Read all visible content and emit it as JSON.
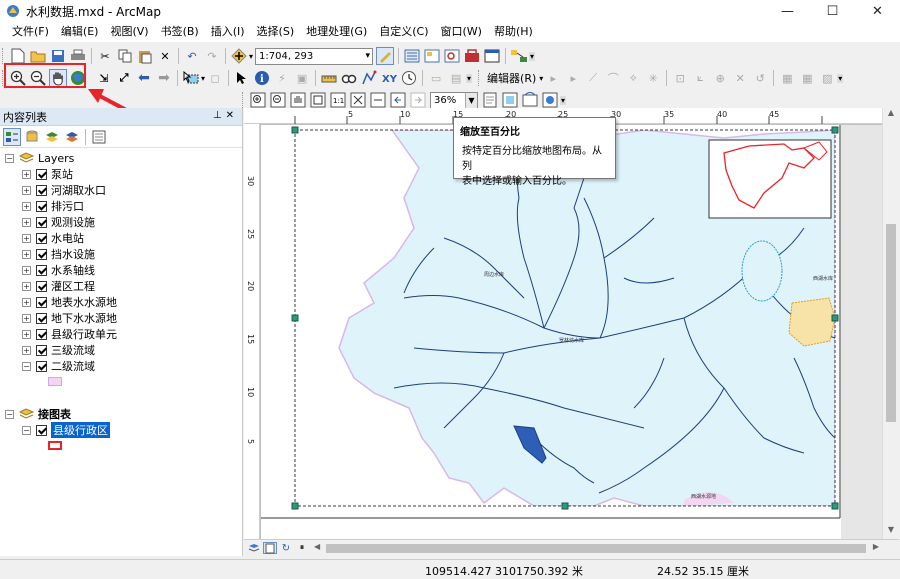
{
  "window": {
    "title": "水利数据.mxd - ArcMap",
    "minimize": "—",
    "maximize": "☐",
    "close": "✕"
  },
  "menu": [
    "文件(F)",
    "编辑(E)",
    "视图(V)",
    "书签(B)",
    "插入(I)",
    "选择(S)",
    "地理处理(G)",
    "自定义(C)",
    "窗口(W)",
    "帮助(H)"
  ],
  "toolbar": {
    "scale": "1:704, 293",
    "editor": "编辑器(R)",
    "zoom_percent": "36%"
  },
  "toc": {
    "title": "内容列表",
    "frames": [
      {
        "name": "Layers",
        "layers": [
          "泵站",
          "河湖取水口",
          "排污口",
          "观测设施",
          "水电站",
          "挡水设施",
          "水系轴线",
          "灌区工程",
          "地表水水源地",
          "地下水水源地",
          "县级行政单元",
          "三级流域",
          "二级流域"
        ]
      },
      {
        "name": "接图表",
        "layers": [
          "县级行政区"
        ]
      }
    ]
  },
  "tooltip": {
    "title": "缩放至百分比",
    "body_line1": "按特定百分比缩放地图布局。从列",
    "body_line2": "表中选择或输入百分比。"
  },
  "ruler": {
    "h_ticks": [
      "5",
      "10",
      "15",
      "20",
      "25",
      "30",
      "35",
      "40",
      "45"
    ],
    "v_ticks": [
      "30",
      "25",
      "20",
      "15",
      "10",
      "5"
    ]
  },
  "map_labels": [
    "罗林坊水库",
    "西湖水库",
    "周边水库",
    "西湖水源地"
  ],
  "status": {
    "coords": "109514.427  3101750.392 米",
    "page": "24.52  35.15 厘米"
  },
  "colors": {
    "highlight": "#e8232a",
    "water": "#dff3fb",
    "river": "#1c3f7a",
    "selection": "#0a64d0"
  }
}
